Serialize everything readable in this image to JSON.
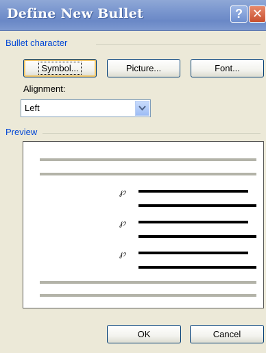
{
  "window": {
    "title": "Define New Bullet",
    "help_glyph": "?",
    "close_glyph": "✕"
  },
  "bullet_group": {
    "label": "Bullet character",
    "buttons": {
      "symbol": "Symbol...",
      "picture": "Picture...",
      "font": "Font..."
    }
  },
  "alignment": {
    "label": "Alignment:",
    "selected": "Left"
  },
  "preview_group": {
    "label": "Preview",
    "bullet_glyph": "℘"
  },
  "actions": {
    "ok": "OK",
    "cancel": "Cancel"
  }
}
